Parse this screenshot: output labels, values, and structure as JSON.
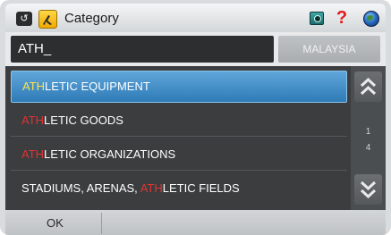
{
  "header": {
    "title": "Category",
    "back_icon": "back-arrow-icon",
    "category_icon": "category-icon",
    "right_icons": [
      "photo-icon",
      "help-icon",
      "globe-icon"
    ]
  },
  "search": {
    "value": "ATH_",
    "country": "MALAYSIA"
  },
  "list": {
    "items": [
      {
        "match": "ATH",
        "rest": "LETIC EQUIPMENT",
        "prefix": ""
      },
      {
        "match": "ATH",
        "rest": "LETIC GOODS",
        "prefix": ""
      },
      {
        "match": "ATH",
        "rest": "LETIC ORGANIZATIONS",
        "prefix": ""
      },
      {
        "match": "ATH",
        "rest": "LETIC FIELDS",
        "prefix": "STADIUMS, ARENAS, "
      }
    ],
    "selected_index": 0
  },
  "pager": {
    "current": "1",
    "total": "4"
  },
  "footer": {
    "ok_label": "OK"
  },
  "colors": {
    "highlight_match": "#e03333",
    "selected_match": "#ffe24a",
    "selection_bg": "#3f8cc8"
  }
}
